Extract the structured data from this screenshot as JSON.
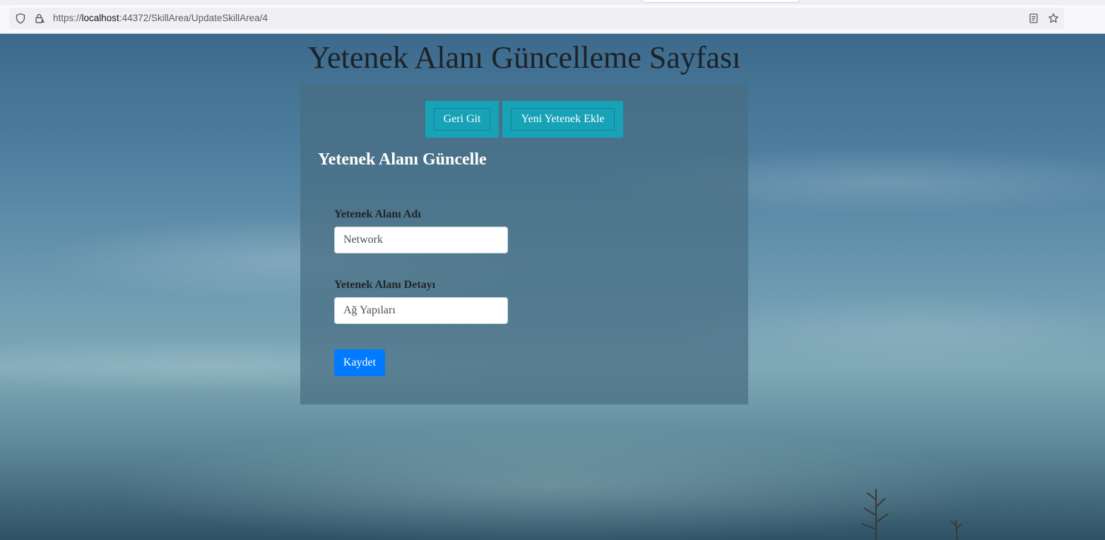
{
  "browser": {
    "url_prefix": "https://",
    "url_host": "localhost",
    "url_rest": ":44372/SkillArea/UpdateSkillArea/4",
    "icons": [
      "shield-icon",
      "lock-warning-icon",
      "reader-mode-icon",
      "bookmark-star-icon"
    ]
  },
  "page": {
    "title": "Yetenek Alanı Güncelleme Sayfası",
    "nav_buttons": {
      "back_label": "Geri Git",
      "add_label": "Yeni Yetenek Ekle"
    },
    "form": {
      "heading": "Yetenek Alanı Güncelle",
      "name_label": "Yetenek Alanı Adı",
      "name_value": "Network",
      "detail_label": "Yetenek Alanı Detayı",
      "detail_value": "Ağ Yapıları",
      "submit_label": "Kaydet"
    }
  },
  "colors": {
    "teal_button": "#17a2b8",
    "primary_button": "#007bff",
    "panel_overlay": "#486e82"
  }
}
